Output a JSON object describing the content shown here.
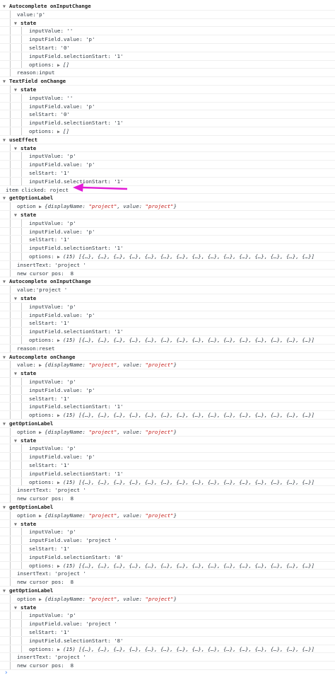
{
  "colors": {
    "arrow": "#e21bd6",
    "guide": "#c8c8c8",
    "string": "#c41a16"
  },
  "icons": {
    "expanded": "triangle-down-icon",
    "collapsed": "triangle-right-icon",
    "prompt": "chevron-right-icon"
  },
  "lines": [
    {
      "t": "Autocomplete onInputChange",
      "k": "h",
      "d": 0,
      "e": 1
    },
    {
      "t": "value:'p'",
      "k": "p",
      "d": 1
    },
    {
      "t": "state",
      "k": "h",
      "d": 1,
      "e": 1
    },
    {
      "t": "inputValue: ''",
      "k": "p",
      "d": 2
    },
    {
      "t": "inputField.value: 'p'",
      "k": "p",
      "d": 2
    },
    {
      "t": "selStart: '0'",
      "k": "p",
      "d": 2
    },
    {
      "t": "inputField.selectionStart: '1'",
      "k": "p",
      "d": 2
    },
    {
      "t": "options: ",
      "k": "o",
      "d": 2,
      "o": "[]"
    },
    {
      "t": "reason:input",
      "k": "p",
      "d": 1
    },
    {
      "t": "TextField onChange",
      "k": "h",
      "d": 0,
      "e": 1
    },
    {
      "t": "state",
      "k": "h",
      "d": 1,
      "e": 1
    },
    {
      "t": "inputValue: ''",
      "k": "p",
      "d": 2
    },
    {
      "t": "inputField.value: 'p'",
      "k": "p",
      "d": 2
    },
    {
      "t": "selStart: '0'",
      "k": "p",
      "d": 2
    },
    {
      "t": "inputField.selectionStart: '1'",
      "k": "p",
      "d": 2
    },
    {
      "t": "options: ",
      "k": "o",
      "d": 2,
      "o": "[]"
    },
    {
      "t": "useEffect",
      "k": "h",
      "d": 0,
      "e": 1
    },
    {
      "t": "state",
      "k": "h",
      "d": 1,
      "e": 1
    },
    {
      "t": "inputValue: 'p'",
      "k": "p",
      "d": 2
    },
    {
      "t": "inputField.value: 'p'",
      "k": "p",
      "d": 2
    },
    {
      "t": "selStart: '1'",
      "k": "p",
      "d": 2
    },
    {
      "t": "inputField.selectionStart: '1'",
      "k": "p",
      "d": 2
    },
    {
      "t": "item clicked: roject",
      "k": "p",
      "d": 0
    },
    {
      "t": "getOptionLabel",
      "k": "h",
      "d": 0,
      "e": 1
    },
    {
      "t": "option ",
      "k": "v",
      "d": 1
    },
    {
      "t": "state",
      "k": "h",
      "d": 1,
      "e": 1
    },
    {
      "t": "inputValue: 'p'",
      "k": "p",
      "d": 2
    },
    {
      "t": "inputField.value: 'p'",
      "k": "p",
      "d": 2
    },
    {
      "t": "selStart: '1'",
      "k": "p",
      "d": 2
    },
    {
      "t": "inputField.selectionStart: '1'",
      "k": "p",
      "d": 2
    },
    {
      "t": "options: ",
      "k": "o",
      "d": 2,
      "o": "(15) [{…}, {…}, {…}, {…}, {…}, {…}, {…}, {…}, {…}, {…}, {…}, {…}, {…}, {…}, {…}]"
    },
    {
      "t": "insertText: 'project '",
      "k": "p",
      "d": 1
    },
    {
      "t": "new cursor pos:  8",
      "k": "p",
      "d": 1
    },
    {
      "t": "Autocomplete onInputChange",
      "k": "h",
      "d": 0,
      "e": 1
    },
    {
      "t": "value:'project '",
      "k": "p",
      "d": 1
    },
    {
      "t": "state",
      "k": "h",
      "d": 1,
      "e": 1
    },
    {
      "t": "inputValue: 'p'",
      "k": "p",
      "d": 2
    },
    {
      "t": "inputField.value: 'p'",
      "k": "p",
      "d": 2
    },
    {
      "t": "selStart: '1'",
      "k": "p",
      "d": 2
    },
    {
      "t": "inputField.selectionStart: '1'",
      "k": "p",
      "d": 2
    },
    {
      "t": "options: ",
      "k": "o",
      "d": 2,
      "o": "(15) [{…}, {…}, {…}, {…}, {…}, {…}, {…}, {…}, {…}, {…}, {…}, {…}, {…}, {…}, {…}]"
    },
    {
      "t": "reason:reset",
      "k": "p",
      "d": 1
    },
    {
      "t": "Autocomplete onChange",
      "k": "h",
      "d": 0,
      "e": 1
    },
    {
      "t": "value: ",
      "k": "v",
      "d": 1
    },
    {
      "t": "state",
      "k": "h",
      "d": 1,
      "e": 1
    },
    {
      "t": "inputValue: 'p'",
      "k": "p",
      "d": 2
    },
    {
      "t": "inputField.value: 'p'",
      "k": "p",
      "d": 2
    },
    {
      "t": "selStart: '1'",
      "k": "p",
      "d": 2
    },
    {
      "t": "inputField.selectionStart: '1'",
      "k": "p",
      "d": 2
    },
    {
      "t": "options: ",
      "k": "o",
      "d": 2,
      "o": "(15) [{…}, {…}, {…}, {…}, {…}, {…}, {…}, {…}, {…}, {…}, {…}, {…}, {…}, {…}, {…}]"
    },
    {
      "t": "getOptionLabel",
      "k": "h",
      "d": 0,
      "e": 1
    },
    {
      "t": "option ",
      "k": "v",
      "d": 1
    },
    {
      "t": "state",
      "k": "h",
      "d": 1,
      "e": 1
    },
    {
      "t": "inputValue: 'p'",
      "k": "p",
      "d": 2
    },
    {
      "t": "inputField.value: 'p'",
      "k": "p",
      "d": 2
    },
    {
      "t": "selStart: '1'",
      "k": "p",
      "d": 2
    },
    {
      "t": "inputField.selectionStart: '1'",
      "k": "p",
      "d": 2
    },
    {
      "t": "options: ",
      "k": "o",
      "d": 2,
      "o": "(15) [{…}, {…}, {…}, {…}, {…}, {…}, {…}, {…}, {…}, {…}, {…}, {…}, {…}, {…}, {…}]"
    },
    {
      "t": "insertText: 'project '",
      "k": "p",
      "d": 1
    },
    {
      "t": "new cursor pos:  8",
      "k": "p",
      "d": 1
    },
    {
      "t": "getOptionLabel",
      "k": "h",
      "d": 0,
      "e": 1
    },
    {
      "t": "option ",
      "k": "v",
      "d": 1
    },
    {
      "t": "state",
      "k": "h",
      "d": 1,
      "e": 1
    },
    {
      "t": "inputValue: 'p'",
      "k": "p",
      "d": 2
    },
    {
      "t": "inputField.value: 'project '",
      "k": "p",
      "d": 2
    },
    {
      "t": "selStart: '1'",
      "k": "p",
      "d": 2
    },
    {
      "t": "inputField.selectionStart: '8'",
      "k": "p",
      "d": 2
    },
    {
      "t": "options: ",
      "k": "o",
      "d": 2,
      "o": "(15) [{…}, {…}, {…}, {…}, {…}, {…}, {…}, {…}, {…}, {…}, {…}, {…}, {…}, {…}, {…}]"
    },
    {
      "t": "insertText: 'project '",
      "k": "p",
      "d": 1
    },
    {
      "t": "new cursor pos:  8",
      "k": "p",
      "d": 1
    },
    {
      "t": "getOptionLabel",
      "k": "h",
      "d": 0,
      "e": 1
    },
    {
      "t": "option ",
      "k": "v",
      "d": 1
    },
    {
      "t": "state",
      "k": "h",
      "d": 1,
      "e": 1
    },
    {
      "t": "inputValue: 'p'",
      "k": "p",
      "d": 2
    },
    {
      "t": "inputField.value: 'project '",
      "k": "p",
      "d": 2
    },
    {
      "t": "selStart: '1'",
      "k": "p",
      "d": 2
    },
    {
      "t": "inputField.selectionStart: '8'",
      "k": "p",
      "d": 2
    },
    {
      "t": "options: ",
      "k": "o",
      "d": 2,
      "o": "(15) [{…}, {…}, {…}, {…}, {…}, {…}, {…}, {…}, {…}, {…}, {…}, {…}, {…}, {…}, {…}]"
    },
    {
      "t": "insertText: 'project '",
      "k": "p",
      "d": 1
    },
    {
      "t": "new cursor pos:  8",
      "k": "p",
      "d": 1
    }
  ],
  "option_object": {
    "open": "{displayName: ",
    "v1": "\"project\"",
    "mid": ", value: ",
    "v2": "\"project\"",
    "close": "}"
  }
}
